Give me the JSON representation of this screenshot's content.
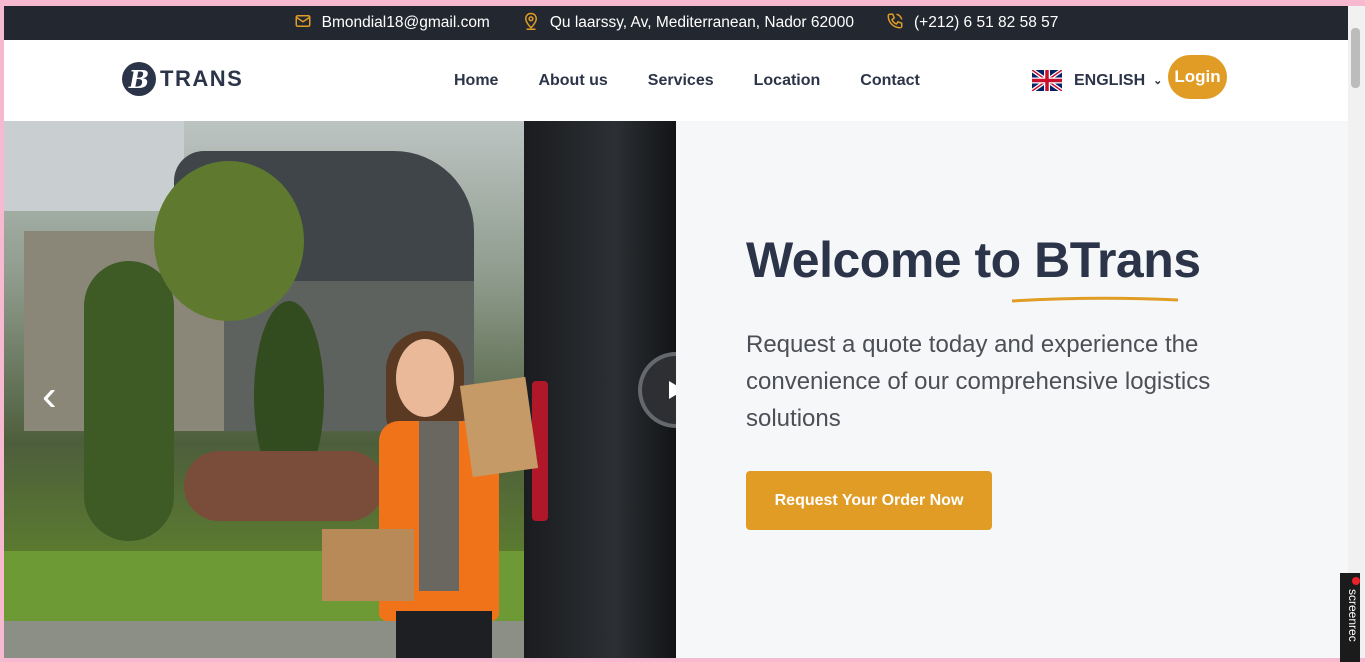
{
  "topbar": {
    "email": "Bmondial18@gmail.com",
    "address": "Qu laarssy, Av, Mediterranean, Nador 62000",
    "phone": "(+212) 6 51 82 58 57"
  },
  "logo": {
    "mark": "B",
    "text": "TRANS"
  },
  "nav": {
    "items": [
      "Home",
      "About us",
      "Services",
      "Location",
      "Contact"
    ],
    "language": "ENGLISH",
    "login": "Login"
  },
  "hero": {
    "title": "Welcome to BTrans",
    "subtitle": "Request a quote today and experience the convenience of our comprehensive logistics solutions",
    "cta": "Request Your Order Now"
  },
  "recorder": {
    "label": "screenrec"
  },
  "colors": {
    "accent": "#e09c25",
    "dark": "#23272f",
    "navy": "#2b3448"
  }
}
